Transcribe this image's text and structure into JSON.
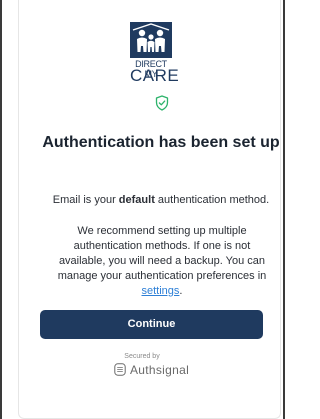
{
  "brand": {
    "logo_line1": "DIRECT MY",
    "logo_line2": "CARE",
    "logo_color": "#1f3a5f"
  },
  "status_icon": "shield-check-icon",
  "title": "Authentication has been set up",
  "default_method": {
    "prefix": "Email is your ",
    "bold": "default",
    "suffix": " authentication method."
  },
  "recommendation": {
    "text": "We recommend setting up multiple authentication methods. If one is not available, you will need a backup. You can manage your authentication preferences in",
    "link": "settings",
    "end": "."
  },
  "continue_button": {
    "label": "Continue",
    "color": "#1f3a5f"
  },
  "footer": {
    "secured_by": "Secured by",
    "provider": "Authsignal",
    "provider_icon": "authsignal-logo-icon"
  },
  "colors": {
    "accent_green": "#2db36b",
    "link_blue": "#2d7fd6"
  }
}
